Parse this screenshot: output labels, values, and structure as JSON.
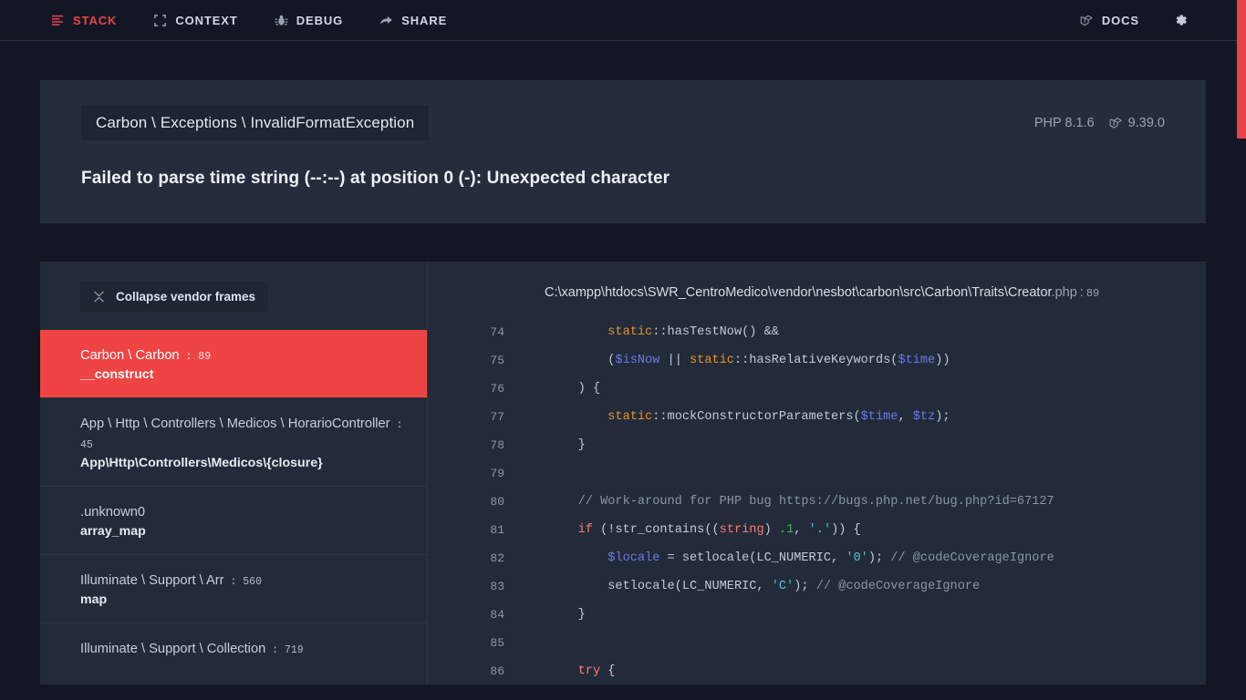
{
  "nav": {
    "left": [
      {
        "label": "STACK",
        "icon": "list-icon",
        "active": true
      },
      {
        "label": "CONTEXT",
        "icon": "brackets-icon",
        "active": false
      },
      {
        "label": "DEBUG",
        "icon": "bug-icon",
        "active": false
      },
      {
        "label": "SHARE",
        "icon": "share-arrow-icon",
        "active": false
      }
    ],
    "right": [
      {
        "label": "DOCS",
        "icon": "laravel-icon"
      }
    ],
    "settings_icon": "gear-icon"
  },
  "exception": {
    "class": "Carbon \\ Exceptions \\ InvalidFormatException",
    "message": "Failed to parse time string (--:--) at position 0 (-): Unexpected character",
    "php_version": "PHP 8.1.6",
    "laravel_version": "9.39.0"
  },
  "frames_panel": {
    "collapse_label": "Collapse vendor frames",
    "collapse_icon": "compress-icon",
    "frames": [
      {
        "class": "Carbon \\ Carbon",
        "line": "89",
        "method": "__construct",
        "selected": true
      },
      {
        "class": "App \\ Http \\ Controllers \\ Medicos \\ HorarioController",
        "line": "45",
        "method": "App\\Http\\Controllers\\Medicos\\{closure}",
        "selected": false
      },
      {
        "class": ".unknown0",
        "line": "",
        "method": "array_map",
        "selected": false
      },
      {
        "class": "Illuminate \\ Support \\ Arr",
        "line": "560",
        "method": "map",
        "selected": false
      },
      {
        "class": "Illuminate \\ Support \\ Collection",
        "line": "719",
        "method": "",
        "selected": false
      }
    ]
  },
  "code_panel": {
    "path_dir": "C:\\xampp\\htdocs\\SWR_CentroMedico\\vendor\\nesbot\\carbon\\src\\Carbon\\Traits\\Creator",
    "path_ext": ".php",
    "path_line": "89",
    "lines": [
      {
        "no": "74",
        "tokens": [
          {
            "t": "        ",
            "c": "t-punc"
          },
          {
            "t": "static",
            "c": "t-static"
          },
          {
            "t": "::hasTestNow() &&",
            "c": "t-punc"
          }
        ]
      },
      {
        "no": "75",
        "tokens": [
          {
            "t": "        (",
            "c": "t-punc"
          },
          {
            "t": "$isNow",
            "c": "t-var"
          },
          {
            "t": " || ",
            "c": "t-punc"
          },
          {
            "t": "static",
            "c": "t-static"
          },
          {
            "t": "::hasRelativeKeywords(",
            "c": "t-punc"
          },
          {
            "t": "$time",
            "c": "t-var"
          },
          {
            "t": "))",
            "c": "t-punc"
          }
        ]
      },
      {
        "no": "76",
        "tokens": [
          {
            "t": "    ) {",
            "c": "t-punc"
          }
        ]
      },
      {
        "no": "77",
        "tokens": [
          {
            "t": "        ",
            "c": "t-punc"
          },
          {
            "t": "static",
            "c": "t-static"
          },
          {
            "t": "::mockConstructorParameters(",
            "c": "t-punc"
          },
          {
            "t": "$time",
            "c": "t-var"
          },
          {
            "t": ", ",
            "c": "t-punc"
          },
          {
            "t": "$tz",
            "c": "t-var"
          },
          {
            "t": ");",
            "c": "t-punc"
          }
        ]
      },
      {
        "no": "78",
        "tokens": [
          {
            "t": "    }",
            "c": "t-punc"
          }
        ]
      },
      {
        "no": "79",
        "tokens": []
      },
      {
        "no": "80",
        "tokens": [
          {
            "t": "    // Work-around for PHP bug https://bugs.php.net/bug.php?id=67127",
            "c": "t-cmt"
          }
        ]
      },
      {
        "no": "81",
        "tokens": [
          {
            "t": "    ",
            "c": "t-punc"
          },
          {
            "t": "if",
            "c": "t-kw"
          },
          {
            "t": " (!str_contains((",
            "c": "t-punc"
          },
          {
            "t": "string",
            "c": "t-kw"
          },
          {
            "t": ") ",
            "c": "t-punc"
          },
          {
            "t": ".1",
            "c": "t-num"
          },
          {
            "t": ", ",
            "c": "t-punc"
          },
          {
            "t": "'.'",
            "c": "t-str"
          },
          {
            "t": ")) {",
            "c": "t-punc"
          }
        ]
      },
      {
        "no": "82",
        "tokens": [
          {
            "t": "        ",
            "c": "t-punc"
          },
          {
            "t": "$locale",
            "c": "t-var"
          },
          {
            "t": " = setlocale(LC_NUMERIC, ",
            "c": "t-punc"
          },
          {
            "t": "'0'",
            "c": "t-str"
          },
          {
            "t": "); ",
            "c": "t-punc"
          },
          {
            "t": "// @codeCoverageIgnore",
            "c": "t-cmt"
          }
        ]
      },
      {
        "no": "83",
        "tokens": [
          {
            "t": "        setlocale(LC_NUMERIC, ",
            "c": "t-punc"
          },
          {
            "t": "'C'",
            "c": "t-str"
          },
          {
            "t": "); ",
            "c": "t-punc"
          },
          {
            "t": "// @codeCoverageIgnore",
            "c": "t-cmt"
          }
        ]
      },
      {
        "no": "84",
        "tokens": [
          {
            "t": "    }",
            "c": "t-punc"
          }
        ]
      },
      {
        "no": "85",
        "tokens": []
      },
      {
        "no": "86",
        "tokens": [
          {
            "t": "    ",
            "c": "t-punc"
          },
          {
            "t": "try",
            "c": "t-kw"
          },
          {
            "t": " {",
            "c": "t-punc"
          }
        ]
      }
    ]
  },
  "colors": {
    "background": "#131725",
    "card": "#252d3d",
    "panel": "#232b3a",
    "accent_red": "#e8444a",
    "selected_frame": "#ef4444"
  }
}
